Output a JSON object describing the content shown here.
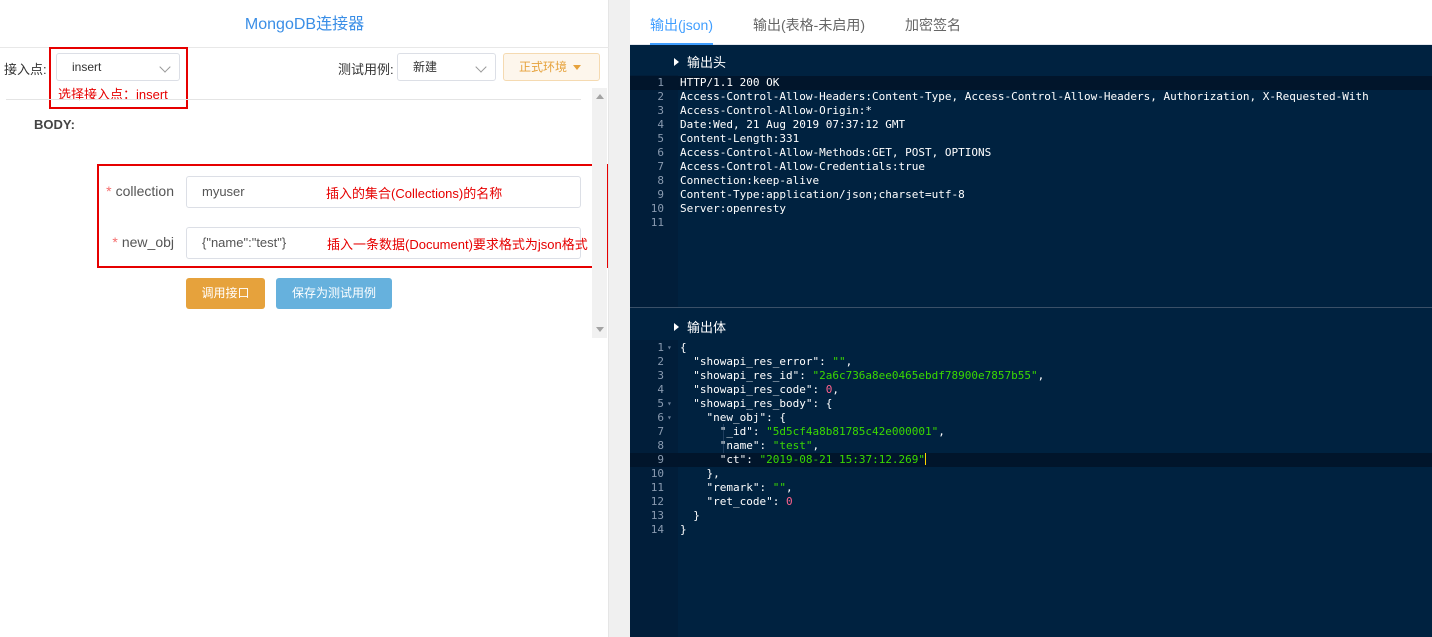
{
  "left": {
    "title": "MongoDB连接器",
    "endpoint_label": "接入点:",
    "endpoint_value": "insert",
    "testcase_label": "测试用例:",
    "testcase_value": "新建",
    "env_button": "正式环境",
    "annotation_endpoint": "选择接入点：insert",
    "body_label": "BODY:",
    "fields": [
      {
        "label": "collection",
        "value": "myuser",
        "annotation": "插入的集合(Collections)的名称"
      },
      {
        "label": "new_obj",
        "value": "{\"name\":\"test\"}",
        "annotation": "插入一条数据(Document)要求格式为json格式"
      }
    ],
    "call_button": "调用接口",
    "save_button": "保存为测试用例"
  },
  "right": {
    "tabs": [
      "输出(json)",
      "输出(表格-未启用)",
      "加密签名"
    ],
    "header_section": "输出头",
    "body_section": "输出体",
    "header_lines": [
      "HTTP/1.1 200 OK",
      "Access-Control-Allow-Headers:Content-Type, Access-Control-Allow-Headers, Authorization, X-Requested-With",
      "Access-Control-Allow-Origin:*",
      "Date:Wed, 21 Aug 2019 07:37:12 GMT",
      "Content-Length:331",
      "Access-Control-Allow-Methods:GET, POST, OPTIONS",
      "Access-Control-Allow-Credentials:true",
      "Connection:keep-alive",
      "Content-Type:application/json;charset=utf-8",
      "Server:openresty",
      ""
    ],
    "body_json": {
      "res_error": "\"\"",
      "res_id": "\"2a6c736a8ee0465ebdf78900e7857b55\"",
      "res_code": "0",
      "obj_id": "\"5d5cf4a8b81785c42e000001\"",
      "obj_name": "\"test\"",
      "obj_ct": "\"2019-08-21 15:37:12.269\"",
      "remark": "\"\"",
      "ret_code": "0"
    }
  },
  "colors": {
    "editor_bg": "#002240",
    "string": "#3ad900",
    "number": "#ff628c",
    "accent": "#409eff",
    "annotation": "#e60000"
  }
}
